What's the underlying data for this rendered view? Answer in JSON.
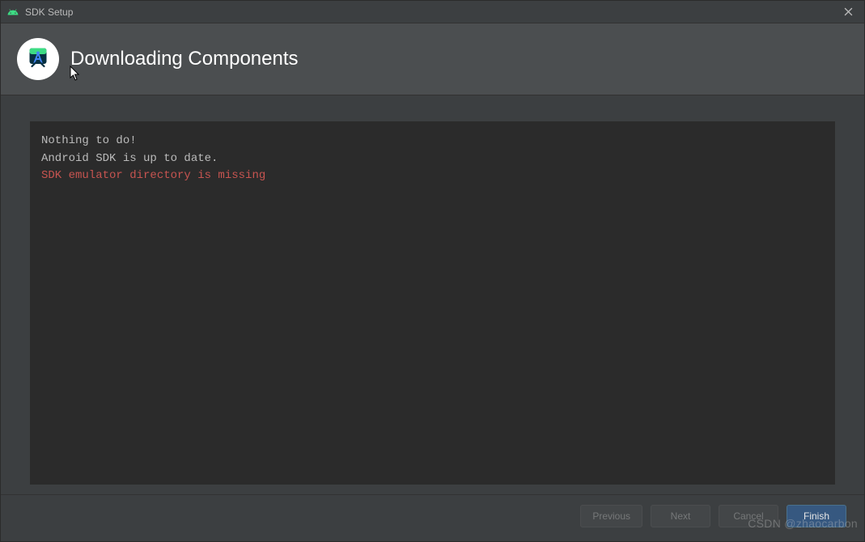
{
  "window": {
    "title": "SDK Setup"
  },
  "header": {
    "heading": "Downloading Components"
  },
  "console": {
    "lines": [
      {
        "text": "Nothing to do!",
        "kind": "normal"
      },
      {
        "text": "Android SDK is up to date.",
        "kind": "normal"
      },
      {
        "text": "SDK emulator directory is missing",
        "kind": "error"
      }
    ]
  },
  "buttons": {
    "previous": "Previous",
    "next": "Next",
    "cancel": "Cancel",
    "finish": "Finish"
  },
  "watermark": "CSDN @zhaocarbon",
  "colors": {
    "windowBg": "#3c3f41",
    "headerBg": "#4b4e50",
    "consoleBg": "#2b2b2b",
    "textNormal": "#bbbbbb",
    "textError": "#c75450",
    "primaryBtn": "#365880"
  },
  "icons": {
    "app": "android-icon",
    "logo": "android-studio-logo",
    "close": "close-icon"
  }
}
